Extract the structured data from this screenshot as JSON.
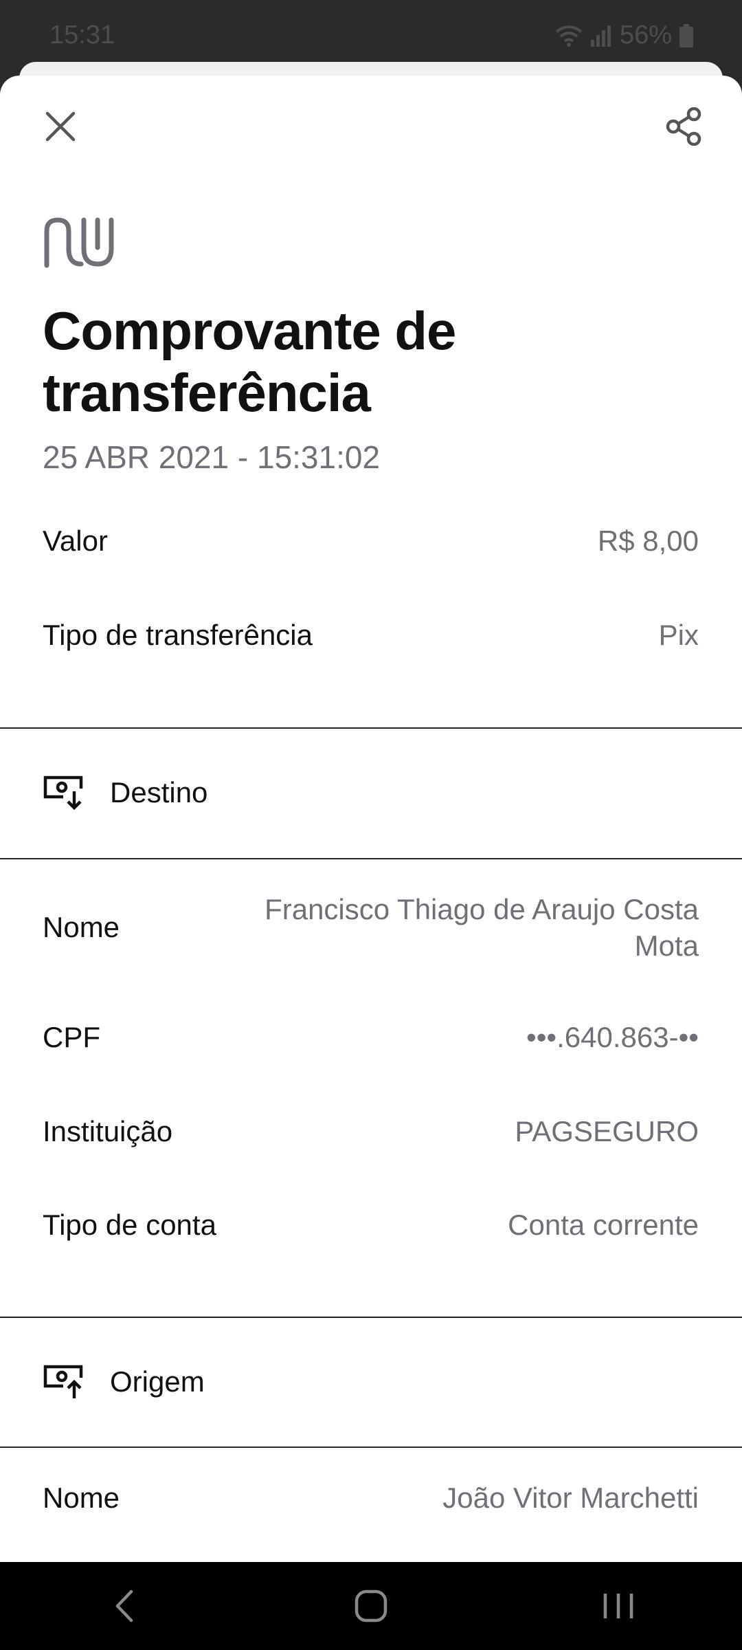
{
  "status_bar": {
    "time": "15:31",
    "battery": "56%"
  },
  "header": {
    "close_icon": "close-icon",
    "share_icon": "share-icon",
    "logo": "nu-logo"
  },
  "receipt": {
    "title": "Comprovante de transferência",
    "date": "25 ABR 2021 - 15:31:02",
    "rows": [
      {
        "label": "Valor",
        "value": "R$ 8,00"
      },
      {
        "label": "Tipo de transferência",
        "value": "Pix"
      }
    ]
  },
  "destino": {
    "title": "Destino",
    "icon": "money-receive-icon",
    "rows": [
      {
        "label": "Nome",
        "value": "Francisco Thiago de Araujo Costa Mota"
      },
      {
        "label": "CPF",
        "value": "•••.640.863-••"
      },
      {
        "label": "Instituição",
        "value": "PAGSEGURO"
      },
      {
        "label": "Tipo de conta",
        "value": "Conta corrente"
      }
    ]
  },
  "origem": {
    "title": "Origem",
    "icon": "money-send-icon",
    "rows": [
      {
        "label": "Nome",
        "value": "João Vitor Marchetti"
      }
    ]
  },
  "nav": {
    "back_icon": "back-icon",
    "home_icon": "home-icon",
    "recents_icon": "recents-icon"
  },
  "colors": {
    "text_primary": "#111111",
    "text_secondary": "#6f6f78",
    "sheet_bg": "#ffffff",
    "status_bg": "#2b2b2b",
    "nav_bg": "#000000"
  }
}
